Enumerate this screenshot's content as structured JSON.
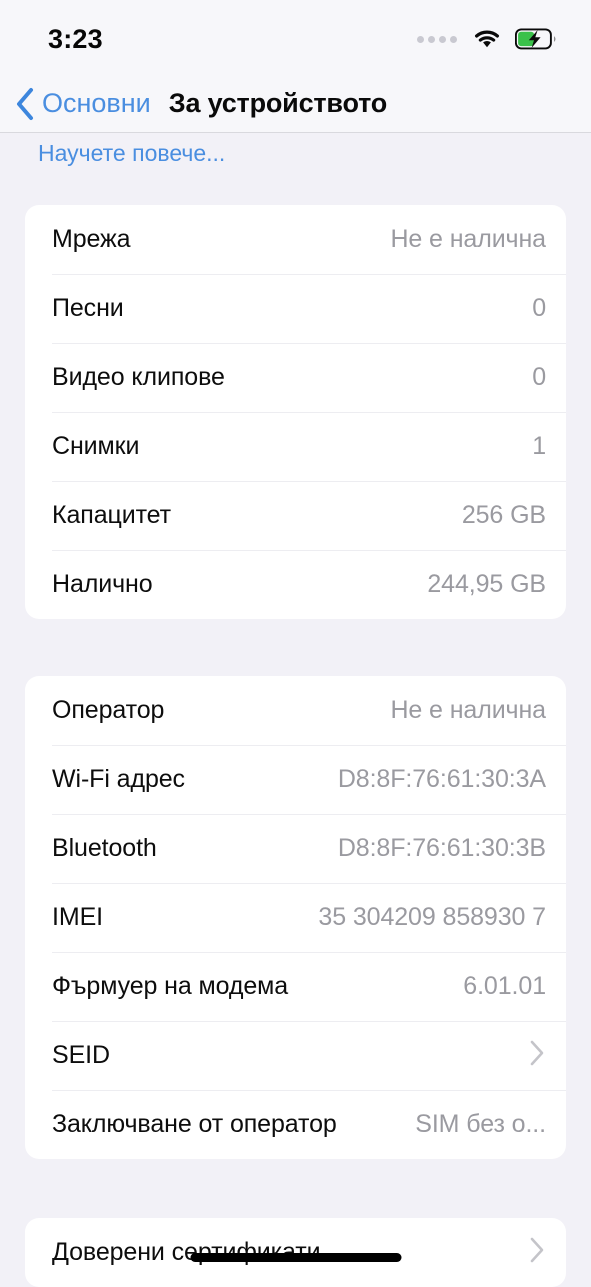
{
  "status_bar": {
    "time": "3:23",
    "icons": [
      "signal-dots-icon",
      "wifi-icon",
      "battery-charging-icon"
    ],
    "battery_color": "#3ac14a"
  },
  "nav": {
    "back_label": "Основни",
    "title": "За устройството",
    "accent_color": "#4a8ee0"
  },
  "content": {
    "learn_more": "Научете повече...",
    "groups": [
      {
        "id": "storage",
        "rows": [
          {
            "label": "Мрежа",
            "value": "Не е налична",
            "chevron": false
          },
          {
            "label": "Песни",
            "value": "0",
            "chevron": false
          },
          {
            "label": "Видео клипове",
            "value": "0",
            "chevron": false
          },
          {
            "label": "Снимки",
            "value": "1",
            "chevron": false
          },
          {
            "label": "Капацитет",
            "value": "256 GB",
            "chevron": false
          },
          {
            "label": "Налично",
            "value": "244,95 GB",
            "chevron": false
          }
        ]
      },
      {
        "id": "hardware",
        "rows": [
          {
            "label": "Оператор",
            "value": "Не е налична",
            "chevron": false
          },
          {
            "label": "Wi-Fi адрес",
            "value": "D8:8F:76:61:30:3A",
            "chevron": false
          },
          {
            "label": "Bluetooth",
            "value": "D8:8F:76:61:30:3B",
            "chevron": false
          },
          {
            "label": "IMEI",
            "value": "35 304209 858930 7",
            "chevron": false
          },
          {
            "label": "Фърмуер на модема",
            "value": "6.01.01",
            "chevron": false
          },
          {
            "label": "SEID",
            "value": "",
            "chevron": true
          },
          {
            "label": "Заключване от оператор",
            "value": "SIM без о...",
            "chevron": false
          }
        ]
      },
      {
        "id": "certs",
        "rows": [
          {
            "label": "Доверени сертификати",
            "value": "",
            "chevron": true
          }
        ]
      }
    ]
  }
}
